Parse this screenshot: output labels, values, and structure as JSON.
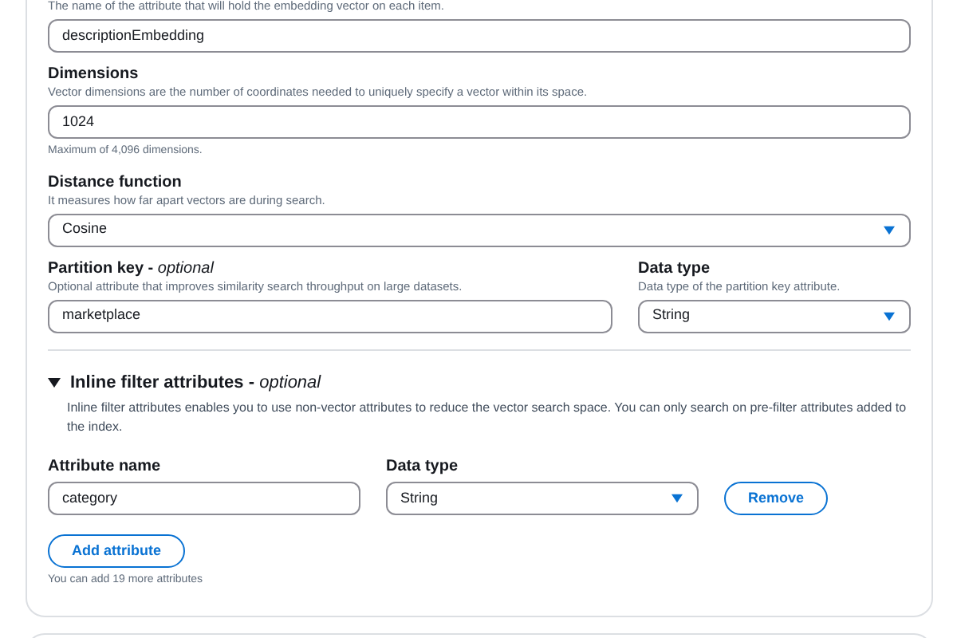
{
  "fields": [
    {
      "description": "The name of the attribute that will hold the embedding vector on each item.",
      "kind": "text",
      "value": "descriptionEmbedding"
    },
    {
      "label": "Dimensions",
      "description": "Vector dimensions are the number of coordinates needed to uniquely specify a vector within its space.",
      "kind": "text",
      "value": "1024",
      "hint": "Maximum of 4,096 dimensions."
    },
    {
      "label": "Distance function",
      "description": "It measures how far apart vectors are during search.",
      "kind": "select",
      "value": "Cosine"
    }
  ],
  "partition_key": {
    "label": "Partition key - *optional*",
    "description": "Optional attribute that improves similarity search throughput on large datasets.",
    "value": "marketplace"
  },
  "partition_data_type": {
    "label": "Data type",
    "description": "Data type of the partition key attribute.",
    "value": "String"
  },
  "inline_filter": {
    "title": "Inline filter attributes - *optional*",
    "expanded": true,
    "description": "Inline filter attributes enables you to use non-vector attributes to reduce the vector search space. You can only search on pre-filter attributes added to the index.",
    "name_label": "Attribute name",
    "type_label": "Data type",
    "attributes": [
      {
        "name": "category",
        "data_type": "String",
        "remove": "Remove"
      }
    ],
    "add_button": "Add attribute",
    "note": "You can add 19 more attributes"
  }
}
